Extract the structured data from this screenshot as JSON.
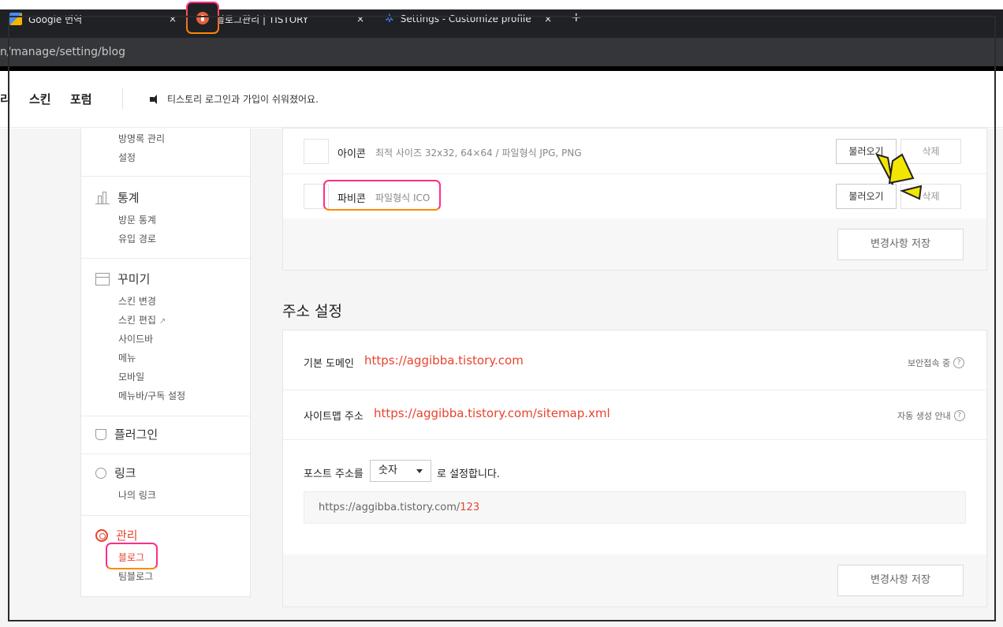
{
  "browser": {
    "tabs": [
      {
        "title": "Google 번역"
      },
      {
        "title": "블로그관리 | TISTORY"
      },
      {
        "title": "Settings - Customize profile"
      }
    ],
    "close_glyph": "×",
    "new_tab_glyph": "+",
    "address": "n/manage/setting/blog"
  },
  "topnav": {
    "items": [
      "리",
      "스킨",
      "포럼"
    ],
    "notice": "티스토리 로그인과 가입이 쉬워졌어요."
  },
  "sidebar": {
    "guestbook": "방명록 관리",
    "settings": "설정",
    "stats": {
      "title": "통계",
      "items": [
        "방문 통계",
        "유입 경로"
      ]
    },
    "decorate": {
      "title": "꾸미기",
      "items": [
        "스킨 변경",
        "스킨 편집",
        "사이드바",
        "메뉴",
        "모바일",
        "메뉴바/구독 설정"
      ]
    },
    "plugin": {
      "title": "플러그인"
    },
    "link": {
      "title": "링크",
      "items": [
        "나의 링크"
      ]
    },
    "manage": {
      "title": "관리",
      "items": [
        "블로그",
        "팀블로그"
      ]
    }
  },
  "icons_panel": {
    "icon": {
      "label": "아이콘",
      "desc": "최적 사이즈 32x32, 64×64 / 파일형식 JPG, PNG",
      "load": "불러오기",
      "delete": "삭제"
    },
    "favicon": {
      "label": "파비콘",
      "desc": "파일형식 ICO",
      "load": "불러오기",
      "delete": "삭제"
    },
    "save": "변경사항 저장"
  },
  "address_settings": {
    "title": "주소 설정",
    "default_domain": {
      "label": "기본 도메인",
      "url": "https://aggibba.tistory.com",
      "info": "보안접속 중"
    },
    "sitemap": {
      "label": "사이트맵 주소",
      "url": "https://aggibba.tistory.com/sitemap.xml",
      "info": "자동 생성 안내"
    },
    "post_url": {
      "prefix": "포스트 주소를",
      "selected": "숫자",
      "suffix": "로 설정합니다.",
      "preview_base": "https://aggibba.tistory.com/",
      "preview_num": "123"
    },
    "save": "변경사항 저장"
  },
  "colors": {
    "accent": "#e8432e",
    "highlight_pink": "#ff2d8a",
    "highlight_orange": "#ff8a00",
    "pointer_yellow": "#f2e600"
  },
  "icons": [
    "speaker-icon",
    "chart-icon",
    "layout-icon",
    "plug-icon",
    "link-icon",
    "gear-icon",
    "external-link-icon",
    "help-icon",
    "caret-down-icon"
  ]
}
